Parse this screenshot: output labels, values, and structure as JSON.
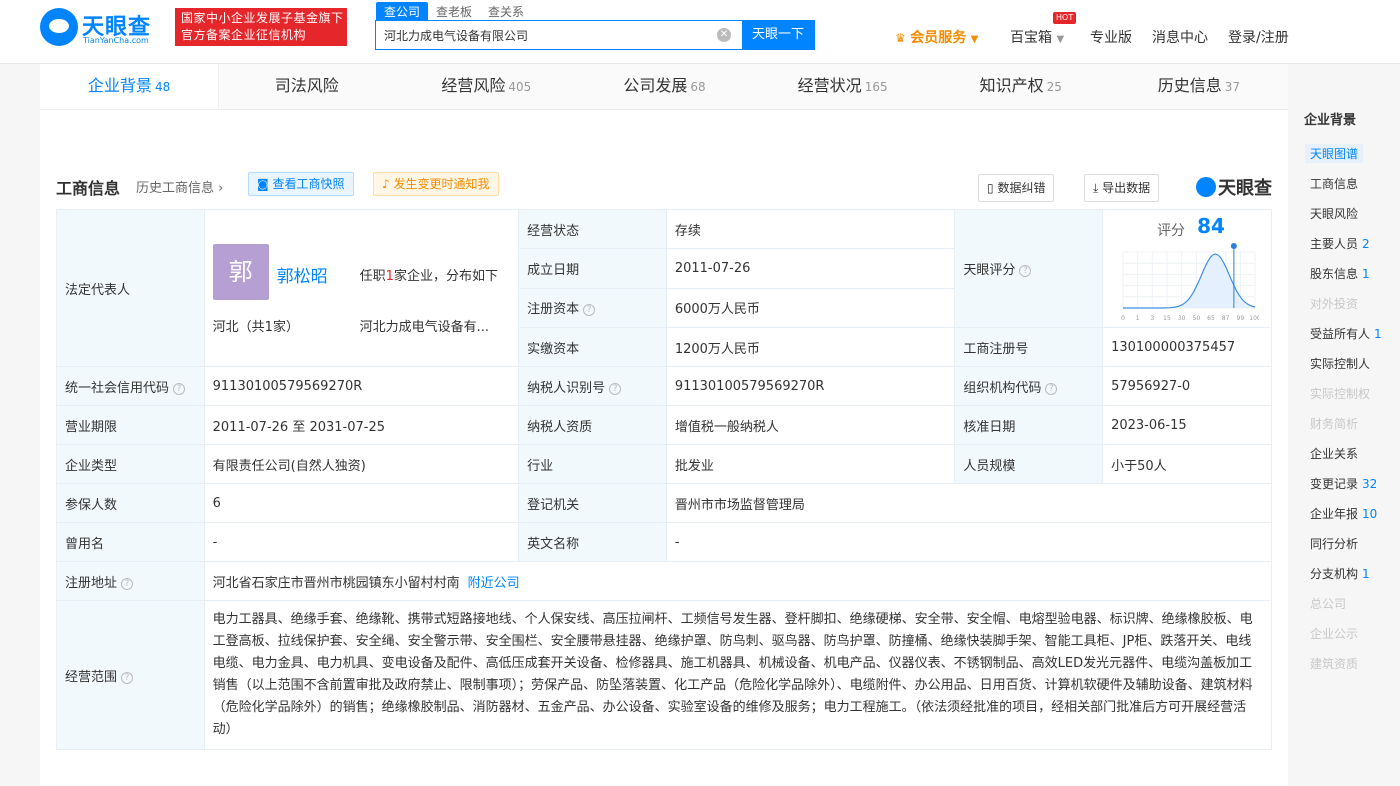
{
  "header": {
    "logo_name": "天眼查",
    "logo_sub": "TianYanCha.com",
    "badge_line1": "国家中小企业发展子基金旗下",
    "badge_line2": "官方备案企业征信机构",
    "search_tabs": [
      "查公司",
      "查老板",
      "查关系"
    ],
    "search_value": "河北力成电气设备有限公司",
    "search_button": "天眼一下",
    "nav": {
      "vip": "会员服务",
      "treasure": "百宝箱",
      "hot": "HOT",
      "pro": "专业版",
      "messages": "消息中心",
      "login": "登录/注册"
    }
  },
  "tabs": [
    {
      "label": "企业背景",
      "count": "48"
    },
    {
      "label": "司法风险",
      "count": ""
    },
    {
      "label": "经营风险",
      "count": "405"
    },
    {
      "label": "公司发展",
      "count": "68"
    },
    {
      "label": "经营状况",
      "count": "165"
    },
    {
      "label": "知识产权",
      "count": "25"
    },
    {
      "label": "历史信息",
      "count": "37"
    }
  ],
  "section": {
    "title": "工商信息",
    "history": "历史工商信息",
    "snapshot_btn": "查看工商快照",
    "notify_btn": "发生变更时通知我",
    "correct_btn": "数据纠错",
    "export_btn": "导出数据",
    "logo": "天眼查"
  },
  "info": {
    "legal_rep_label": "法定代表人",
    "avatar_char": "郭",
    "legal_rep_name": "郭松昭",
    "legal_rep_desc_pre": "任职",
    "legal_rep_desc_num": "1",
    "legal_rep_desc_post": "家企业，分布如下",
    "province_pre": "河北（共",
    "province_num": "1",
    "province_post": "家）",
    "legal_company": "河北力成电气设备有...",
    "status_label": "经营状态",
    "status": "存续",
    "founded_label": "成立日期",
    "founded": "2011-07-26",
    "reg_cap_label": "注册资本",
    "reg_cap": "6000万人民币",
    "paid_cap_label": "实缴资本",
    "paid_cap": "1200万人民币",
    "score_label": "天眼评分",
    "score_title": "评分",
    "score": "84",
    "reg_no_label": "工商注册号",
    "reg_no": "130100000375457",
    "credit_code_label": "统一社会信用代码",
    "credit_code": "91130100579569270R",
    "tax_id_label": "纳税人识别号",
    "tax_id": "91130100579569270R",
    "org_code_label": "组织机构代码",
    "org_code": "57956927-0",
    "term_label": "营业期限",
    "term": "2011-07-26 至 2031-07-25",
    "tax_quality_label": "纳税人资质",
    "tax_quality": "增值税一般纳税人",
    "approve_label": "核准日期",
    "approve": "2023-06-15",
    "type_label": "企业类型",
    "type": "有限责任公司(自然人独资)",
    "industry_label": "行业",
    "industry": "批发业",
    "staff_label": "人员规模",
    "staff": "小于50人",
    "insured_label": "参保人数",
    "insured": "6",
    "reg_org_label": "登记机关",
    "reg_org": "晋州市市场监督管理局",
    "former_label": "曾用名",
    "former": "-",
    "en_label": "英文名称",
    "en": "-",
    "addr_label": "注册地址",
    "addr": "河北省石家庄市晋州市桃园镇东小留村村南",
    "addr_link": "附近公司",
    "scope_label": "经营范围",
    "scope": "电力工器具、绝缘手套、绝缘靴、携带式短路接地线、个人保安线、高压拉闸杆、工频信号发生器、登杆脚扣、绝缘硬梯、安全带、安全帽、电熔型验电器、标识牌、绝缘橡胶板、电工登高板、拉线保护套、安全绳、安全警示带、安全围栏、安全腰带悬挂器、绝缘护罩、防鸟刺、驱鸟器、防鸟护罩、防撞桶、绝缘快装脚手架、智能工具柜、JP柜、跌落开关、电线电缆、电力金具、电力机具、变电设备及配件、高低压成套开关设备、检修器具、施工机器具、机械设备、机电产品、仪器仪表、不锈钢制品、高效LED发光元器件、电缆沟盖板加工销售（以上范围不含前置审批及政府禁止、限制事项）；劳保产品、防坠落装置、化工产品（危险化学品除外）、电缆附件、办公用品、日用百货、计算机软硬件及辅助设备、建筑材料（危险化学品除外）的销售；绝缘橡胶制品、消防器材、五金产品、办公设备、实验室设备的维修及服务；电力工程施工。（依法须经批准的项目，经相关部门批准后方可开展经营活动）"
  },
  "score_axis": [
    "0",
    "1",
    "3",
    "15",
    "30",
    "50",
    "65",
    "87",
    "99",
    "100"
  ],
  "score_value": 84,
  "sidebar": {
    "title": "企业背景",
    "items": [
      {
        "label": "天眼图谱",
        "count": "",
        "state": "active"
      },
      {
        "label": "工商信息",
        "count": "",
        "state": "normal"
      },
      {
        "label": "天眼风险",
        "count": "",
        "state": "normal"
      },
      {
        "label": "主要人员",
        "count": "2",
        "state": "normal"
      },
      {
        "label": "股东信息",
        "count": "1",
        "state": "normal"
      },
      {
        "label": "对外投资",
        "count": "",
        "state": "disabled"
      },
      {
        "label": "受益所有人",
        "count": "1",
        "state": "normal"
      },
      {
        "label": "实际控制人",
        "count": "",
        "state": "normal"
      },
      {
        "label": "实际控制权",
        "count": "",
        "state": "disabled"
      },
      {
        "label": "财务简析",
        "count": "",
        "state": "disabled"
      },
      {
        "label": "企业关系",
        "count": "",
        "state": "normal"
      },
      {
        "label": "变更记录",
        "count": "32",
        "state": "normal"
      },
      {
        "label": "企业年报",
        "count": "10",
        "state": "normal"
      },
      {
        "label": "同行分析",
        "count": "",
        "state": "normal"
      },
      {
        "label": "分支机构",
        "count": "1",
        "state": "normal"
      },
      {
        "label": "总公司",
        "count": "",
        "state": "disabled"
      },
      {
        "label": "企业公示",
        "count": "",
        "state": "disabled"
      },
      {
        "label": "建筑资质",
        "count": "",
        "state": "disabled"
      }
    ]
  },
  "colors": {
    "brand": "#0084ff",
    "red": "#e5262b",
    "orange": "#f28c00"
  }
}
